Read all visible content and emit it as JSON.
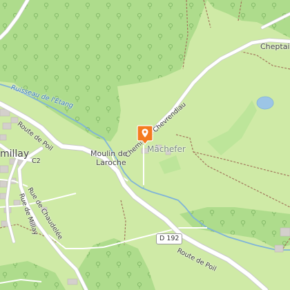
{
  "map": {
    "places": {
      "millay": "millay",
      "moulin_line1": "Moulin de",
      "moulin_line2": "Laroche",
      "machefer": "Mâchefer",
      "cheptain": "Cheptain"
    },
    "roads": {
      "route_poil_upper": "Route de Poil",
      "route_poil_lower": "Route de Poil",
      "chemin": "Chemin de Chevrendiau",
      "rue_chaudelee": "Rue de Chaudelée",
      "rue_millay": "Rue de Millay",
      "c2": "C2"
    },
    "shields": {
      "d192": "D 192"
    },
    "water": {
      "ruisseau": "Ruisseau de l'Etang"
    },
    "marker": {
      "icon": "map-pin-icon",
      "color": "#f47b20"
    },
    "colors": {
      "meadow": "#cfeaa6",
      "forest": "#aedc8c",
      "road": "#ffffff",
      "road_casing": "#c9c9c9",
      "water": "#9cc5e6",
      "stream": "#7fb3d9",
      "building": "#d4d0cc",
      "boundary": "#a1745a"
    }
  }
}
